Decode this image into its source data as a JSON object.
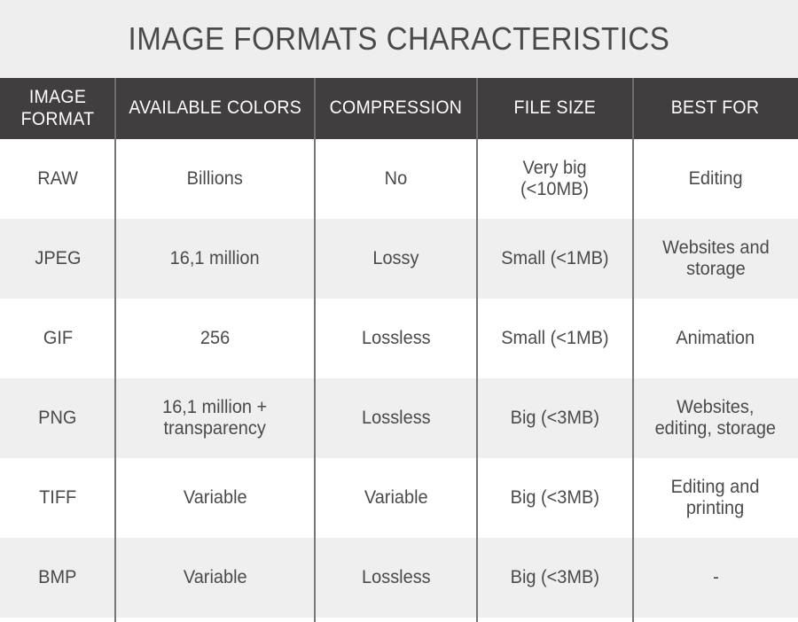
{
  "page": {
    "title": "IMAGE FORMATS CHARACTERISTICS",
    "colors": {
      "title_band_background": "#eeeeee",
      "header_background": "#403e3e",
      "header_text": "#ffffff",
      "body_text": "#4a4a4a",
      "row_light": "#ffffff",
      "row_shade": "#efefef",
      "divider": "#767676"
    }
  },
  "table": {
    "columns": [
      {
        "label": "IMAGE\nFORMAT",
        "key": "format"
      },
      {
        "label": "AVAILABLE\nCOLORS",
        "key": "colors"
      },
      {
        "label": "COMPRESSION",
        "key": "compression"
      },
      {
        "label": "FILE SIZE",
        "key": "file_size"
      },
      {
        "label": "BEST FOR",
        "key": "best_for"
      }
    ],
    "rows": [
      {
        "format": "RAW",
        "colors": "Billions",
        "compression": "No",
        "file_size": "Very big\n(<10MB)",
        "best_for": "Editing"
      },
      {
        "format": "JPEG",
        "colors": "16,1 million",
        "compression": "Lossy",
        "file_size": "Small (<1MB)",
        "best_for": "Websites and\nstorage"
      },
      {
        "format": "GIF",
        "colors": "256",
        "compression": "Lossless",
        "file_size": "Small (<1MB)",
        "best_for": "Animation"
      },
      {
        "format": "PNG",
        "colors": "16,1 million +\ntransparency",
        "compression": "Lossless",
        "file_size": "Big (<3MB)",
        "best_for": "Websites,\nediting, storage"
      },
      {
        "format": "TIFF",
        "colors": "Variable",
        "compression": "Variable",
        "file_size": "Big (<3MB)",
        "best_for": "Editing and\nprinting"
      },
      {
        "format": "BMP",
        "colors": "Variable",
        "compression": "Lossless",
        "file_size": "Big (<3MB)",
        "best_for": "-"
      }
    ]
  }
}
